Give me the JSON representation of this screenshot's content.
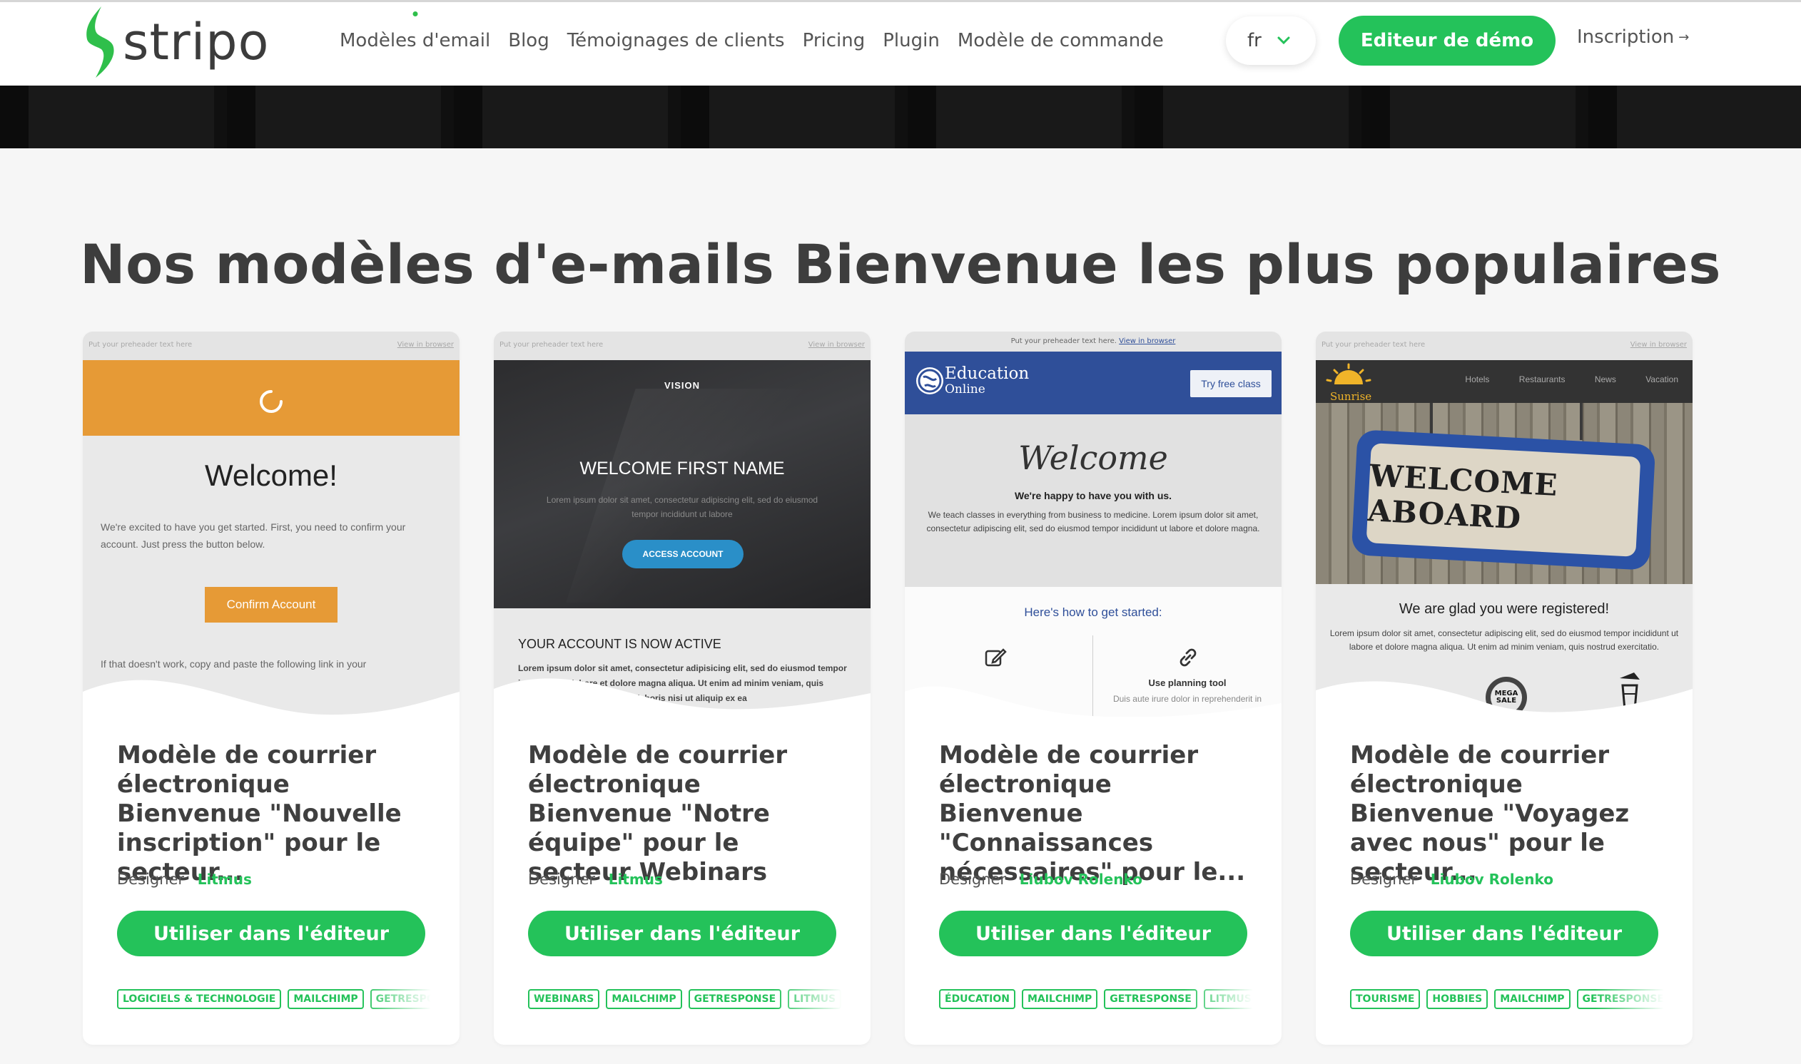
{
  "header": {
    "logo_text": "stripo",
    "nav": [
      {
        "label": "Modèles d'email",
        "active_dot": true
      },
      {
        "label": "Blog"
      },
      {
        "label": "Témoignages de clients"
      },
      {
        "label": "Pricing"
      },
      {
        "label": "Plugin"
      },
      {
        "label": "Modèle de commande"
      }
    ],
    "lang": "fr",
    "demo_button": "Editeur de démo",
    "signup": "Inscription",
    "signup_arrow": "→"
  },
  "section_title": "Nos modèles d'e-mails Bienvenue les plus populaires",
  "card_common": {
    "designer_label": "Designer",
    "use_button": "Utiliser dans l'éditeur"
  },
  "cards": [
    {
      "title": "Modèle de courrier électronique Bienvenue \"Nouvelle inscription\" pour le secteur...",
      "designer": "Litmus",
      "tags": [
        "LOGICIELS & TECHNOLOGIE",
        "MAILCHIMP",
        "GETRESPONSE"
      ],
      "preview": {
        "preheader": "Put your preheader text here",
        "view_in_browser": "View in browser",
        "heading": "Welcome!",
        "text": "We're excited to have you get started. First, you need to confirm your account. Just press the button below.",
        "button": "Confirm Account",
        "text2": "If that doesn't work, copy and paste the following link in your",
        "accent": "#e69a36"
      }
    },
    {
      "title": "Modèle de courrier électronique Bienvenue \"Notre équipe\" pour le secteur Webinars",
      "designer": "Litmus",
      "tags": [
        "WEBINARS",
        "MAILCHIMP",
        "GETRESPONSE",
        "LITMUS"
      ],
      "preview": {
        "preheader": "Put your preheader text here",
        "view_in_browser": "View in browser",
        "brand": "VISION",
        "heading": "WELCOME FIRST NAME",
        "lorem": "Lorem ipsum dolor sit amet, consectetur adipiscing elit, sed do eiusmod tempor incididunt ut labore",
        "button": "ACCESS ACCOUNT",
        "subheading": "YOUR ACCOUNT IS NOW ACTIVE",
        "body": "Lorem ipsum dolor sit amet, consectetur adipisicing elit, sed do eiusmod tempor incididunt ut labore et dolore magna aliqua. Ut enim ad minim veniam, quis nostrud exercitation ullamco laboris nisi ut aliquip ex ea",
        "accent": "#2a8fc8"
      }
    },
    {
      "title": "Modèle de courrier électronique Bienvenue \"Connaissances nécessaires\" pour le...",
      "designer": "Liubov Rolenko",
      "tags": [
        "ÉDUCATION",
        "MAILCHIMP",
        "GETRESPONSE",
        "LITMUS"
      ],
      "preview": {
        "preheader": "Put your preheader text here.",
        "view_in_browser": "View in browser",
        "brand_line1": "Education",
        "brand_line2": "Online",
        "cta": "Try free class",
        "heading": "Welcome",
        "subheading": "We're happy to have you with us.",
        "text": "We teach classes in everything from business to medicine. Lorem ipsum dolor sit amet, consectetur adipiscing elit, sed do eiusmod tempor incididunt ut labore et dolore magna.",
        "how": "Here's how to get started:",
        "feature": "Use planning tool",
        "feature_text": "Duis aute irure dolor in reprehenderit in",
        "accent": "#2f4f99"
      }
    },
    {
      "title": "Modèle de courrier électronique Bienvenue \"Voyagez avec nous\" pour le secteur...",
      "designer": "Liubov Rolenko",
      "tags": [
        "TOURISME",
        "HOBBIES",
        "MAILCHIMP",
        "GETRESPONSE"
      ],
      "preview": {
        "preheader": "Put your preheader text here",
        "view_in_browser": "View in browser",
        "brand": "Sunrise",
        "menu": [
          "Hotels",
          "Restaurants",
          "News",
          "Vacation"
        ],
        "sign_text": "WELCOME ABOARD",
        "heading": "We are glad you were registered!",
        "text": "Lorem ipsum dolor sit amet, consectetur adipiscing elit, sed do eiusmod tempor incididunt ut labore et dolore magna aliqua. Ut enim ad minim veniam, quis nostrud exercitatio.",
        "badge": "MEGA SALE",
        "accent": "#2b52a6"
      }
    }
  ],
  "colors": {
    "brand_green": "#24c25a",
    "background": "#f6f6f6",
    "title": "#3d3d3d"
  }
}
